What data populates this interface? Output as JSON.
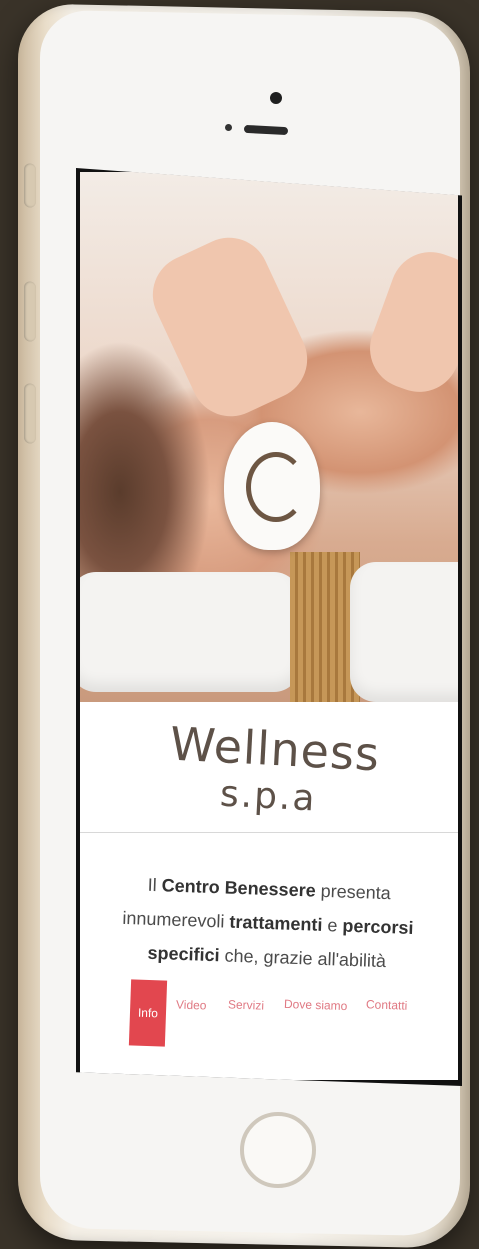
{
  "brand": {
    "name": "Wellness",
    "suffix": "s.p.a"
  },
  "intro": {
    "t1": "Il ",
    "b1": "Centro Benessere",
    "t2": " presenta innumerevoli ",
    "b2": "trattamenti",
    "t3": " e ",
    "b3": "percorsi specifici",
    "t4": " che, grazie all'abilità"
  },
  "tabs": [
    {
      "label": "Info",
      "active": true
    },
    {
      "label": "Video"
    },
    {
      "label": "Servizi"
    },
    {
      "label": "Dove siamo"
    },
    {
      "label": "Contatti"
    }
  ],
  "colors": {
    "accent": "#e2474f",
    "tab_text": "#e07a84",
    "brand_text": "#5d5148"
  }
}
